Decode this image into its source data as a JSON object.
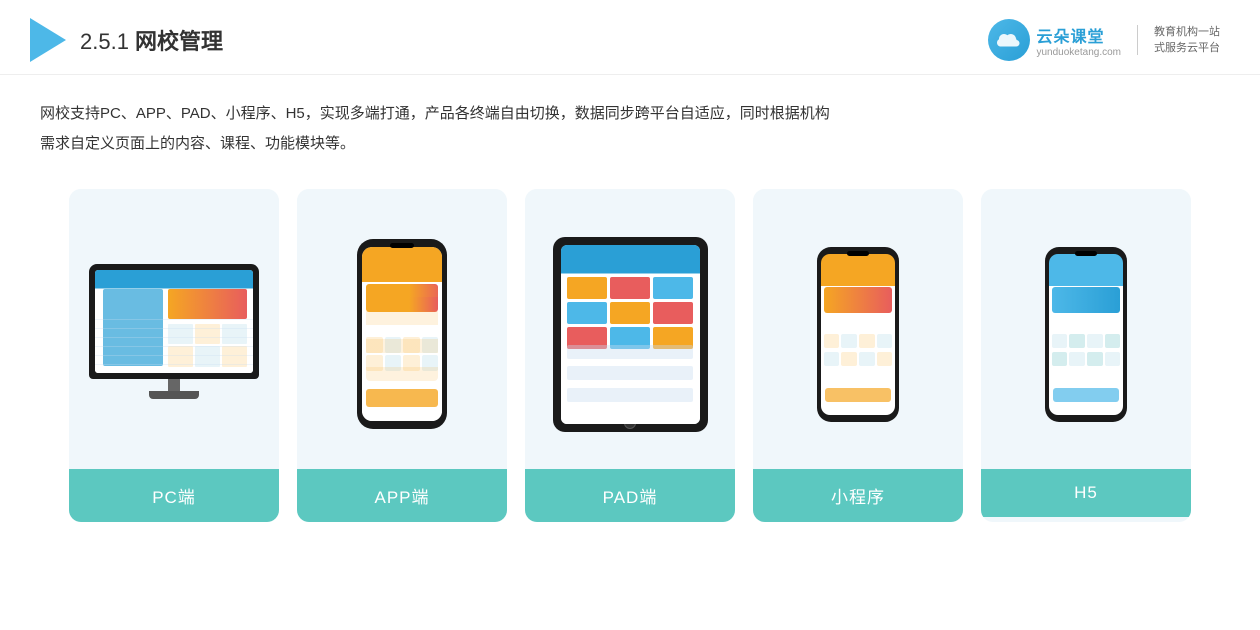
{
  "header": {
    "section_number": "2.5.1",
    "title_prefix": "2.5.1 ",
    "title_bold": "网校管理",
    "logo": {
      "cloud_symbol": "☁",
      "brand_name": "云朵课堂",
      "brand_url": "yunduoketang.com",
      "divider_text": "|",
      "slogan_line1": "教育机构一站",
      "slogan_line2": "式服务云平台"
    }
  },
  "description": {
    "text": "网校支持PC、APP、PAD、小程序、H5，实现多端打通，产品各终端自由切换，数据同步跨平台自适应，同时根据机构",
    "text2": "需求自定义页面上的内容、课程、功能模块等。"
  },
  "cards": [
    {
      "id": "pc",
      "label": "PC端",
      "device_type": "pc"
    },
    {
      "id": "app",
      "label": "APP端",
      "device_type": "phone"
    },
    {
      "id": "pad",
      "label": "PAD端",
      "device_type": "pad"
    },
    {
      "id": "miniprogram",
      "label": "小程序",
      "device_type": "phone_small"
    },
    {
      "id": "h5",
      "label": "H5",
      "device_type": "phone_small_blue"
    }
  ]
}
